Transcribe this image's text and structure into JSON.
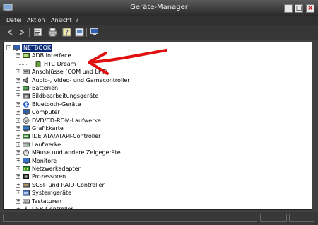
{
  "window": {
    "title": "Geräte-Manager",
    "controls": {
      "minimize": "_",
      "maximize": "□",
      "close": "×"
    }
  },
  "menu": [
    "Datei",
    "Aktion",
    "Ansicht",
    "?"
  ],
  "toolbar": [
    "back-icon",
    "forward-icon",
    "properties-icon",
    "print-icon",
    "help-icon",
    "show-hidden-icon",
    "computer-icon"
  ],
  "tree": {
    "root": "NETBOOK",
    "items": [
      {
        "label": "ADB Interface",
        "icon": "adb-icon",
        "expanded": true
      },
      {
        "label": "HTC Dream",
        "icon": "phone-icon",
        "child": true
      },
      {
        "label": "Anschlüsse (COM und LPT)",
        "icon": "port-icon"
      },
      {
        "label": "Audio-, Video- und Gamecontroller",
        "icon": "audio-icon"
      },
      {
        "label": "Batterien",
        "icon": "battery-icon"
      },
      {
        "label": "Bildbearbeitungsgeräte",
        "icon": "camera-icon"
      },
      {
        "label": "Bluetooth-Geräte",
        "icon": "bluetooth-icon"
      },
      {
        "label": "Computer",
        "icon": "computer-icon"
      },
      {
        "label": "DVD/CD-ROM-Laufwerke",
        "icon": "cdrom-icon"
      },
      {
        "label": "Grafikkarte",
        "icon": "display-adapter-icon"
      },
      {
        "label": "IDE ATA/ATAPI-Controller",
        "icon": "ide-icon"
      },
      {
        "label": "Laufwerke",
        "icon": "drive-icon"
      },
      {
        "label": "Mäuse und andere Zeigegeräte",
        "icon": "mouse-icon"
      },
      {
        "label": "Monitore",
        "icon": "monitor-icon"
      },
      {
        "label": "Netzwerkadapter",
        "icon": "network-icon"
      },
      {
        "label": "Prozessoren",
        "icon": "cpu-icon"
      },
      {
        "label": "SCSI- und RAID-Controller",
        "icon": "scsi-icon"
      },
      {
        "label": "Systemgeräte",
        "icon": "system-icon"
      },
      {
        "label": "Tastaturen",
        "icon": "keyboard-icon"
      },
      {
        "label": "USB-Controller",
        "icon": "usb-icon"
      }
    ]
  },
  "annotation": {
    "arrow_color": "#e01010"
  }
}
